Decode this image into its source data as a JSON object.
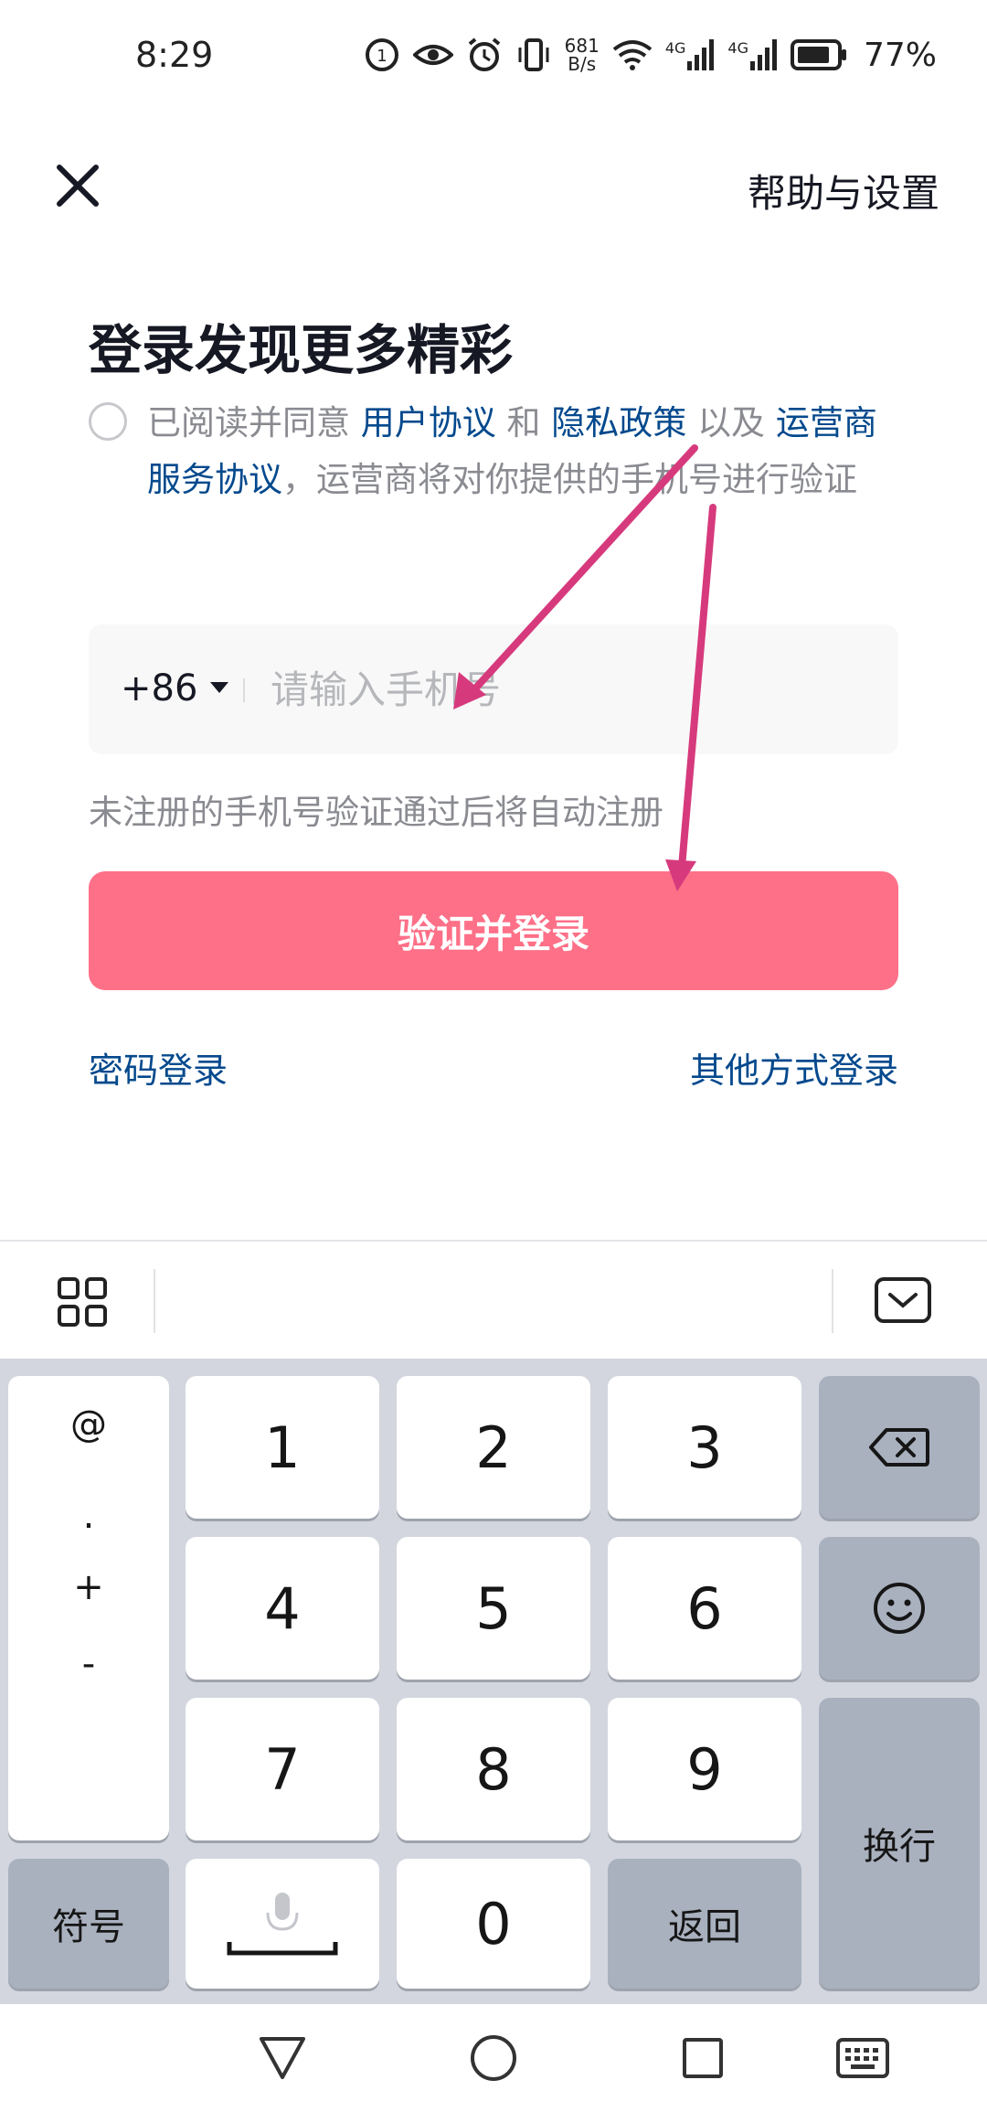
{
  "status_bar": {
    "time": "8:29",
    "net_speed_top": "681",
    "net_speed_bottom": "B/s",
    "signal_label_1": "4G",
    "signal_label_2": "4G",
    "battery": "77%"
  },
  "header": {
    "help_settings": "帮助与设置"
  },
  "title": "登录发现更多精彩",
  "agreement": {
    "prefix": "已阅读并同意",
    "user_agreement": "用户协议",
    "and": "和",
    "privacy_policy": "隐私政策",
    "also": "以及",
    "carrier_agreement": "运营商服务协议",
    "suffix": "，运营商将对你提供的手机号进行验证"
  },
  "phone": {
    "country_code": "+86",
    "placeholder": "请输入手机号",
    "value": ""
  },
  "hint": "未注册的手机号验证通过后将自动注册",
  "login_button": "验证并登录",
  "password_login": "密码登录",
  "other_login": "其他方式登录",
  "keyboard": {
    "symbols": [
      "@",
      ".",
      "+",
      "-"
    ],
    "keys": [
      "1",
      "2",
      "3",
      "4",
      "5",
      "6",
      "7",
      "8",
      "9",
      "0"
    ],
    "symbols_key": "符号",
    "return_key": "返回",
    "enter_key": "换行"
  },
  "colors": {
    "accent": "#fe7088",
    "link": "#04498d",
    "annotation_arrow": "#d63a7d"
  }
}
